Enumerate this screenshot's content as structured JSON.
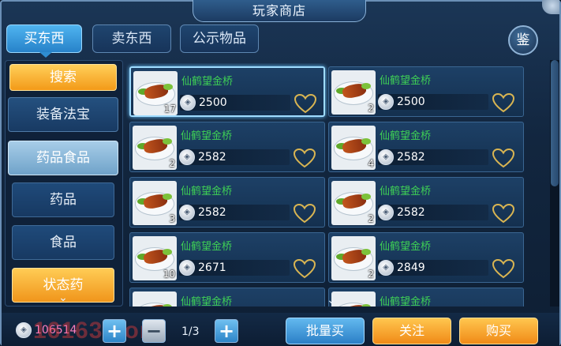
{
  "window": {
    "title": "玩家商店",
    "appraise_label": "鉴"
  },
  "tabs": [
    {
      "label": "买东西",
      "active": true
    },
    {
      "label": "卖东西",
      "active": false
    },
    {
      "label": "公示物品",
      "active": false
    }
  ],
  "sidebar": {
    "search_label": "搜索",
    "categories": [
      {
        "label": "装备法宝",
        "selected": false
      },
      {
        "label": "药品食品",
        "selected": true
      }
    ],
    "subcategories": [
      {
        "label": "药品"
      },
      {
        "label": "食品"
      },
      {
        "label": "状态药"
      }
    ]
  },
  "items": [
    {
      "name": "仙鹤望金桥",
      "qty": "17",
      "price": "2500"
    },
    {
      "name": "仙鹤望金桥",
      "qty": "2",
      "price": "2500"
    },
    {
      "name": "仙鹤望金桥",
      "qty": "2",
      "price": "2582"
    },
    {
      "name": "仙鹤望金桥",
      "qty": "4",
      "price": "2582"
    },
    {
      "name": "仙鹤望金桥",
      "qty": "3",
      "price": "2582"
    },
    {
      "name": "仙鹤望金桥",
      "qty": "2",
      "price": "2582"
    },
    {
      "name": "仙鹤望金桥",
      "qty": "10",
      "price": "2671"
    },
    {
      "name": "仙鹤望金桥",
      "qty": "2",
      "price": "2849"
    },
    {
      "name": "仙鹤望金桥",
      "qty": "",
      "price": ""
    },
    {
      "name": "仙鹤望金桥",
      "qty": "",
      "price": ""
    }
  ],
  "footer": {
    "money": "106514",
    "watermark": "16163.com",
    "page": "1/3",
    "batch_buy_label": "批量买",
    "follow_label": "关注",
    "buy_label": "购买"
  },
  "colors": {
    "item_name": "#3ed055",
    "money": "#ff7fbf",
    "selection_glow": "#9fdcff"
  }
}
